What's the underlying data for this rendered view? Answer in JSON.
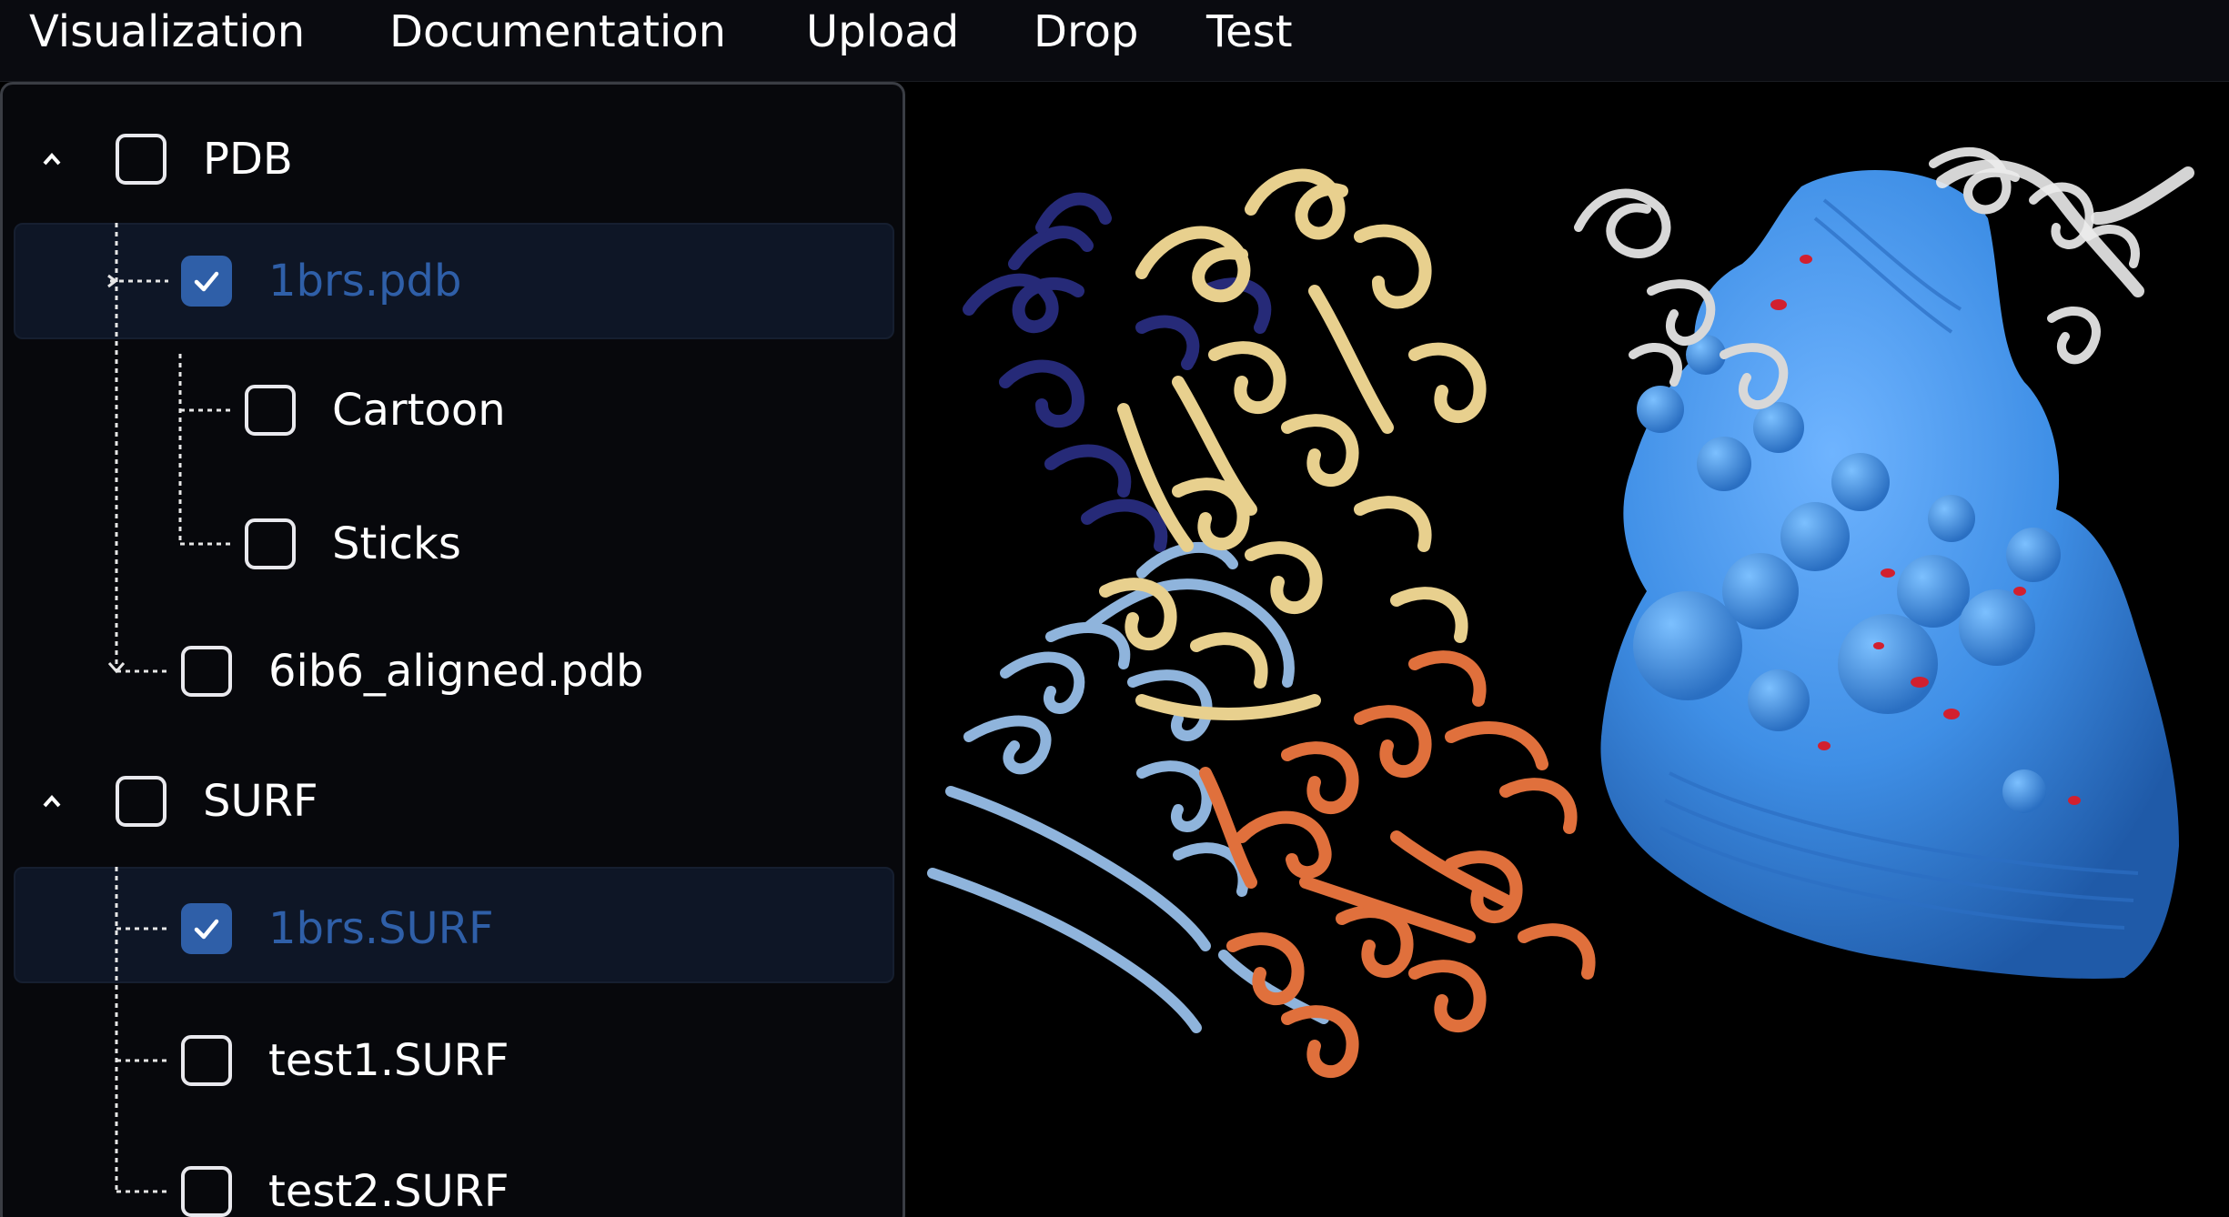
{
  "menu": {
    "items": [
      "Visualization",
      "Documentation",
      "Upload",
      "Drop",
      "Test"
    ]
  },
  "tree": {
    "groups": [
      {
        "label": "PDB",
        "checked": false,
        "expanded": true,
        "children": [
          {
            "label": "1brs.pdb",
            "checked": true,
            "selected": true,
            "children": [
              {
                "label": "Cartoon",
                "checked": false
              },
              {
                "label": "Sticks",
                "checked": false
              }
            ]
          },
          {
            "label": "6ib6_aligned.pdb",
            "checked": false,
            "selected": false
          }
        ]
      },
      {
        "label": "SURF",
        "checked": false,
        "expanded": true,
        "children": [
          {
            "label": "1brs.SURF",
            "checked": true,
            "selected": true
          },
          {
            "label": "test1.SURF",
            "checked": false,
            "selected": false
          },
          {
            "label": "test2.SURF",
            "checked": false,
            "selected": false
          }
        ]
      }
    ]
  },
  "colors": {
    "accent": "#2f5fa8",
    "navy_ribbon": "#262a78",
    "gold_ribbon": "#e8d08e",
    "lightblue_ribbon": "#8fb4dc",
    "orange_ribbon": "#e0703c",
    "white_ribbon": "#d8d8d8",
    "surface": "#3f8fe6",
    "surface_highlight": "#d2202f"
  }
}
